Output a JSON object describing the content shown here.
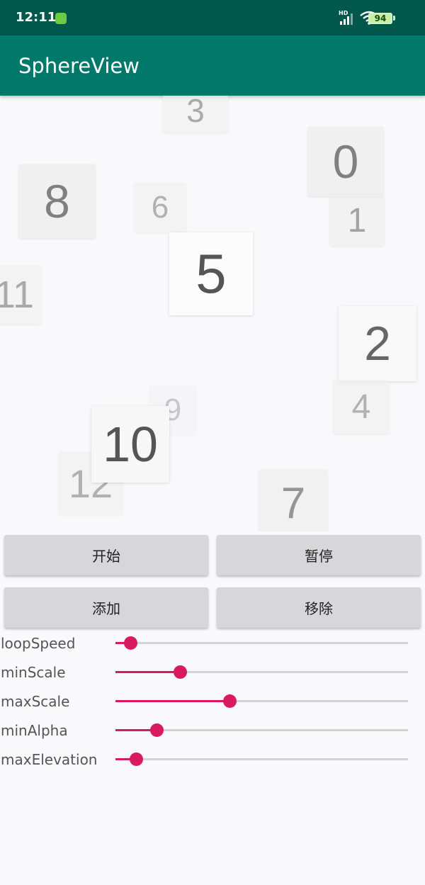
{
  "status_bar": {
    "time": "12:11",
    "network_label": "HD",
    "battery": "94",
    "icons": [
      "app-notification-icon",
      "signal-icon",
      "wifi-icon",
      "battery-icon"
    ]
  },
  "app_bar": {
    "title": "SphereView"
  },
  "sphere_tags": [
    "3",
    "0",
    "8",
    "6",
    "1",
    "5",
    "11",
    "2",
    "9",
    "4",
    "10",
    "12",
    "7"
  ],
  "buttons": {
    "start": "开始",
    "pause": "暂停",
    "add": "添加",
    "remove": "移除"
  },
  "sliders": [
    {
      "label": "loopSpeed",
      "value": 0.05
    },
    {
      "label": "minScale",
      "value": 0.22
    },
    {
      "label": "maxScale",
      "value": 0.39
    },
    {
      "label": "minAlpha",
      "value": 0.14
    },
    {
      "label": "maxElevation",
      "value": 0.07
    }
  ],
  "colors": {
    "status_bar": "#00574c",
    "app_bar": "#00796b",
    "accent": "#d81b60",
    "button": "#d7d6d8",
    "background": "#f9f8fa"
  }
}
